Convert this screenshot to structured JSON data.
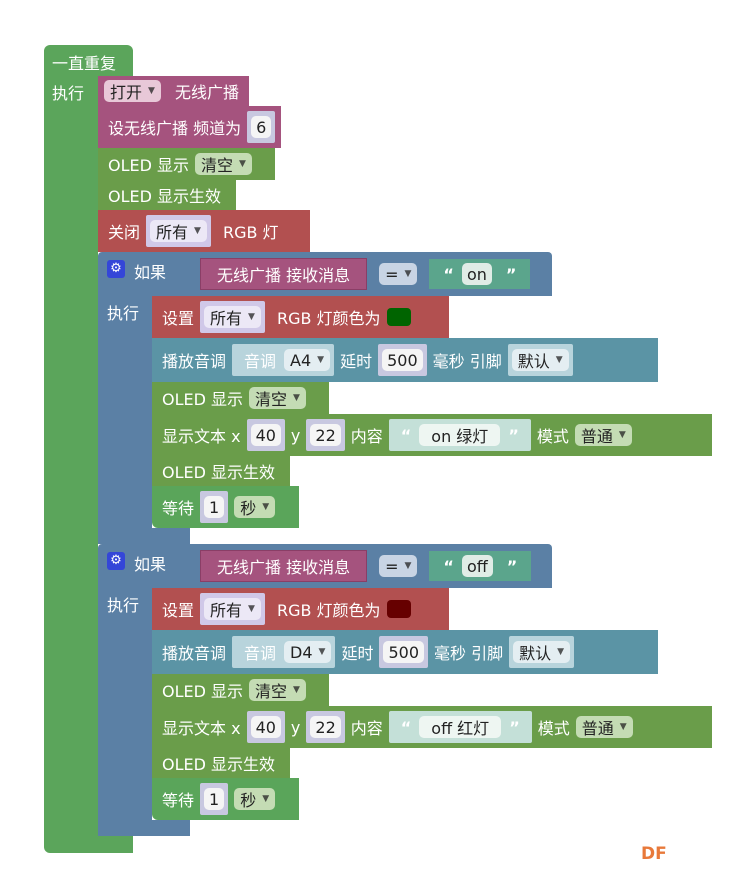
{
  "colors": {
    "loop": "#5ba55b",
    "radio": "#a5537e",
    "oled": "#6a9d4a",
    "rgb": "#b25050",
    "if": "#5b80a5",
    "tone": "#5b94a5",
    "text": "#5ba58c",
    "watermark": "#e8793a",
    "rgb_on_color": "#006400",
    "rgb_off_color": "#660000"
  },
  "loop": {
    "title": "一直重复",
    "do_label": "执行"
  },
  "setup": {
    "radio_onoff": {
      "value": "打开",
      "label": "无线广播"
    },
    "radio_channel": {
      "label": "设无线广播 频道为",
      "value": "6"
    },
    "oled_clear": {
      "label": "OLED 显示",
      "value": "清空"
    },
    "oled_show": {
      "label": "OLED 显示生效"
    },
    "rgb_off": {
      "label": "关闭",
      "which": "所有",
      "suffix": "RGB 灯"
    }
  },
  "if_blocks": [
    {
      "if_label": "如果",
      "do_label": "执行",
      "cond": {
        "left": "无线广播 接收消息",
        "op": "=",
        "value": "on"
      },
      "set_rgb": {
        "label": "设置",
        "which": "所有",
        "suffix": "RGB 灯颜色为"
      },
      "tone": {
        "label": "播放音调",
        "tone_label": "音调",
        "note": "A4",
        "delay_label": "延时",
        "delay": "500",
        "ms_pin": "毫秒 引脚",
        "pin": "默认"
      },
      "oled_clear": {
        "label": "OLED 显示",
        "value": "清空"
      },
      "text": {
        "label": "显示文本 x",
        "x": "40",
        "y_label": "y",
        "y": "22",
        "content_label": "内容",
        "content": "on 绿灯",
        "mode_label": "模式",
        "mode": "普通"
      },
      "oled_show": {
        "label": "OLED 显示生效"
      },
      "wait": {
        "label": "等待",
        "value": "1",
        "unit": "秒"
      }
    },
    {
      "if_label": "如果",
      "do_label": "执行",
      "cond": {
        "left": "无线广播 接收消息",
        "op": "=",
        "value": "off"
      },
      "set_rgb": {
        "label": "设置",
        "which": "所有",
        "suffix": "RGB 灯颜色为"
      },
      "tone": {
        "label": "播放音调",
        "tone_label": "音调",
        "note": "D4",
        "delay_label": "延时",
        "delay": "500",
        "ms_pin": "毫秒 引脚",
        "pin": "默认"
      },
      "oled_clear": {
        "label": "OLED 显示",
        "value": "清空"
      },
      "text": {
        "label": "显示文本 x",
        "x": "40",
        "y_label": "y",
        "y": "22",
        "content_label": "内容",
        "content": "off 红灯",
        "mode_label": "模式",
        "mode": "普通"
      },
      "oled_show": {
        "label": "OLED 显示生效"
      },
      "wait": {
        "label": "等待",
        "value": "1",
        "unit": "秒"
      }
    }
  ],
  "watermark": "DF"
}
